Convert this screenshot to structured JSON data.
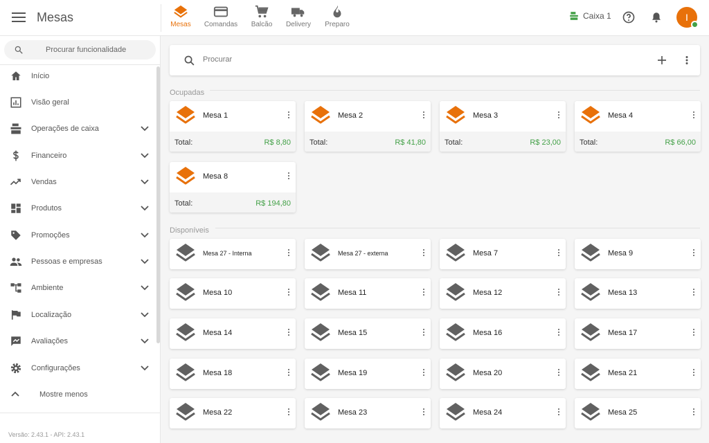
{
  "app": {
    "title": "Mesas"
  },
  "nav_tabs": [
    {
      "label": "Mesas",
      "icon": "layers-icon",
      "active": true
    },
    {
      "label": "Comandas",
      "icon": "card-icon",
      "active": false
    },
    {
      "label": "Balcão",
      "icon": "cart-icon",
      "active": false
    },
    {
      "label": "Delivery",
      "icon": "truck-icon",
      "active": false
    },
    {
      "label": "Preparo",
      "icon": "flame-icon",
      "active": false
    }
  ],
  "header": {
    "caixa_label": "Caixa 1",
    "avatar_initial": "I"
  },
  "sidebar": {
    "search_placeholder": "Procurar funcionalidade",
    "items": [
      {
        "label": "Início",
        "icon": "home-icon",
        "expandable": false
      },
      {
        "label": "Visão geral",
        "icon": "chart-icon",
        "expandable": false
      },
      {
        "label": "Operações de caixa",
        "icon": "register-icon",
        "expandable": true
      },
      {
        "label": "Financeiro",
        "icon": "dollar-icon",
        "expandable": true
      },
      {
        "label": "Vendas",
        "icon": "trend-icon",
        "expandable": true
      },
      {
        "label": "Produtos",
        "icon": "dashboard-icon",
        "expandable": true
      },
      {
        "label": "Promoções",
        "icon": "tag-icon",
        "expandable": true
      },
      {
        "label": "Pessoas e empresas",
        "icon": "people-icon",
        "expandable": true
      },
      {
        "label": "Ambiente",
        "icon": "tree-icon",
        "expandable": true
      },
      {
        "label": "Localização",
        "icon": "flag-icon",
        "expandable": true
      },
      {
        "label": "Avaliações",
        "icon": "rate-icon",
        "expandable": true
      },
      {
        "label": "Configurações",
        "icon": "gear-icon",
        "expandable": true
      }
    ],
    "show_less": "Mostre menos",
    "version": "Versão: 2.43.1 - API: 2.43.1"
  },
  "search": {
    "placeholder": "Procurar"
  },
  "sections": {
    "occupied": "Ocupadas",
    "available": "Disponíveis"
  },
  "occupied_total_label": "Total:",
  "occupied": [
    {
      "name": "Mesa 1",
      "total": "R$ 8,80"
    },
    {
      "name": "Mesa 2",
      "total": "R$ 41,80"
    },
    {
      "name": "Mesa 3",
      "total": "R$ 23,00"
    },
    {
      "name": "Mesa 4",
      "total": "R$ 66,00"
    },
    {
      "name": "Mesa 8",
      "total": "R$ 194,80"
    }
  ],
  "available": [
    "Mesa 27 - Interna",
    "Mesa 27 - externa",
    "Mesa 7",
    "Mesa 9",
    "Mesa 10",
    "Mesa 11",
    "Mesa 12",
    "Mesa 13",
    "Mesa 14",
    "Mesa 15",
    "Mesa 16",
    "Mesa 17",
    "Mesa 18",
    "Mesa 19",
    "Mesa 20",
    "Mesa 21",
    "Mesa 22",
    "Mesa 23",
    "Mesa 24",
    "Mesa 25"
  ],
  "colors": {
    "accent": "#e8710a",
    "occupied": "#e8710a",
    "available": "#616161",
    "money": "#43a047"
  }
}
